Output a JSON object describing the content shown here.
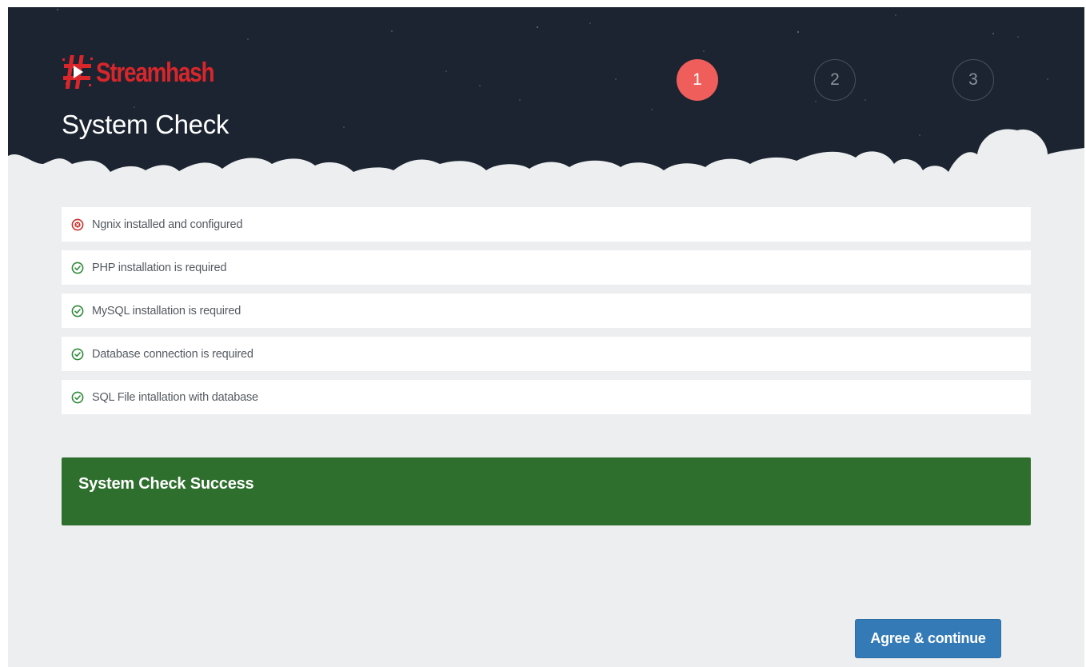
{
  "header": {
    "logo_text": "Streamhash",
    "title": "System Check"
  },
  "steps": [
    {
      "label": "1",
      "active": true
    },
    {
      "label": "2",
      "active": false
    },
    {
      "label": "3",
      "active": false
    }
  ],
  "checks": [
    {
      "label": "Ngnix installed and configured",
      "status": "failed",
      "icon": "error-circle-icon"
    },
    {
      "label": "PHP installation is required",
      "status": "passed",
      "icon": "check-circle-icon"
    },
    {
      "label": "MySQL installation is required",
      "status": "passed",
      "icon": "check-circle-icon"
    },
    {
      "label": "Database connection is required",
      "status": "passed",
      "icon": "check-circle-icon"
    },
    {
      "label": "SQL File intallation with database",
      "status": "passed",
      "icon": "check-circle-icon"
    }
  ],
  "result": {
    "message": "System Check Success"
  },
  "actions": {
    "agree_label": "Agree & continue"
  },
  "colors": {
    "header_bg": "#1b2430",
    "accent_step": "#ef5e5a",
    "success_bg": "#2f6f2e",
    "pass_icon": "#2e8b3a",
    "fail_icon": "#c9302c",
    "button_bg": "#337ab7"
  }
}
